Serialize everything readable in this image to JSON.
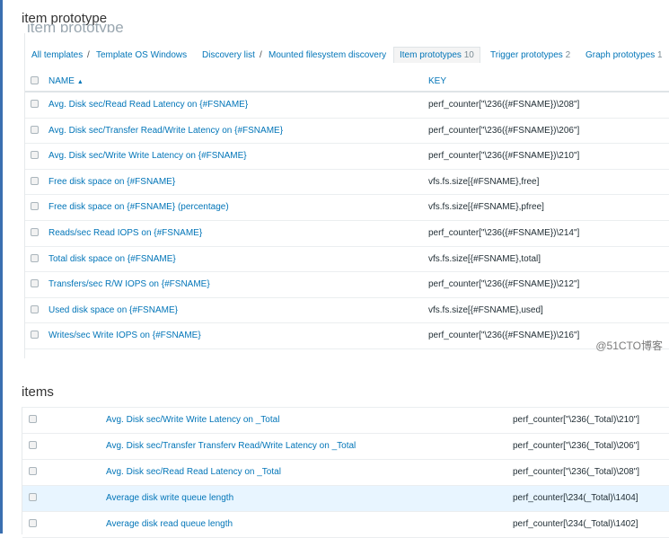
{
  "sections": {
    "prototypes_title": "item prototype",
    "items_title": "items"
  },
  "breadcrumbs": {
    "all_templates": "All templates",
    "sep1": "/",
    "template": "Template OS Windows",
    "discovery_list": "Discovery list",
    "sep2": "/",
    "discovery_rule": "Mounted filesystem discovery",
    "tab_item_prototypes": "Item prototypes",
    "tab_item_prototypes_count": "10",
    "tab_trigger_prototypes": "Trigger prototypes",
    "tab_trigger_prototypes_count": "2",
    "tab_graph_prototypes": "Graph prototypes",
    "tab_graph_prototypes_count": "1"
  },
  "prototype_table": {
    "headers": {
      "name": "NAME",
      "sort_glyph": "▲",
      "key": "KEY"
    },
    "rows": [
      {
        "name": "Avg. Disk sec/Read Read Latency on {#FSNAME}",
        "key": "perf_counter[\"\\236({#FSNAME})\\208\"]"
      },
      {
        "name": "Avg. Disk sec/Transfer Read/Write Latency on {#FSNAME}",
        "key": "perf_counter[\"\\236({#FSNAME})\\206\"]"
      },
      {
        "name": "Avg. Disk sec/Write Write Latency on {#FSNAME}",
        "key": "perf_counter[\"\\236({#FSNAME})\\210\"]"
      },
      {
        "name": "Free disk space on {#FSNAME}",
        "key": "vfs.fs.size[{#FSNAME},free]"
      },
      {
        "name": "Free disk space on {#FSNAME} (percentage)",
        "key": "vfs.fs.size[{#FSNAME},pfree]"
      },
      {
        "name": "Reads/sec Read IOPS on {#FSNAME}",
        "key": "perf_counter[\"\\236({#FSNAME})\\214\"]"
      },
      {
        "name": "Total disk space on {#FSNAME}",
        "key": "vfs.fs.size[{#FSNAME},total]"
      },
      {
        "name": "Transfers/sec R/W IOPS on {#FSNAME}",
        "key": "perf_counter[\"\\236({#FSNAME})\\212\"]"
      },
      {
        "name": "Used disk space on {#FSNAME}",
        "key": "vfs.fs.size[{#FSNAME},used]"
      },
      {
        "name": "Writes/sec Write IOPS on {#FSNAME}",
        "key": "perf_counter[\"\\236({#FSNAME})\\216\"]"
      }
    ]
  },
  "watermark": "@51CTO博客",
  "items_table": {
    "rows": [
      {
        "name": "Avg. Disk sec/Write Write Latency on _Total",
        "key": "perf_counter[\"\\236(_Total)\\210\"]"
      },
      {
        "name": "Avg. Disk sec/Transfer Transferv Read/Write Latency on _Total",
        "key": "perf_counter[\"\\236(_Total)\\206\"]"
      },
      {
        "name": "Avg. Disk sec/Read Read Latency on _Total",
        "key": "perf_counter[\"\\236(_Total)\\208\"]"
      },
      {
        "name": "Average disk write queue length",
        "key": "perf_counter[\\234(_Total)\\1404]"
      },
      {
        "name": "Average disk read queue length",
        "key": "perf_counter[\\234(_Total)\\1402]"
      }
    ]
  },
  "colors": {
    "link": "#0275b8",
    "accent_bar": "#3a6fb0",
    "row_highlight": "#e8f5ff"
  }
}
